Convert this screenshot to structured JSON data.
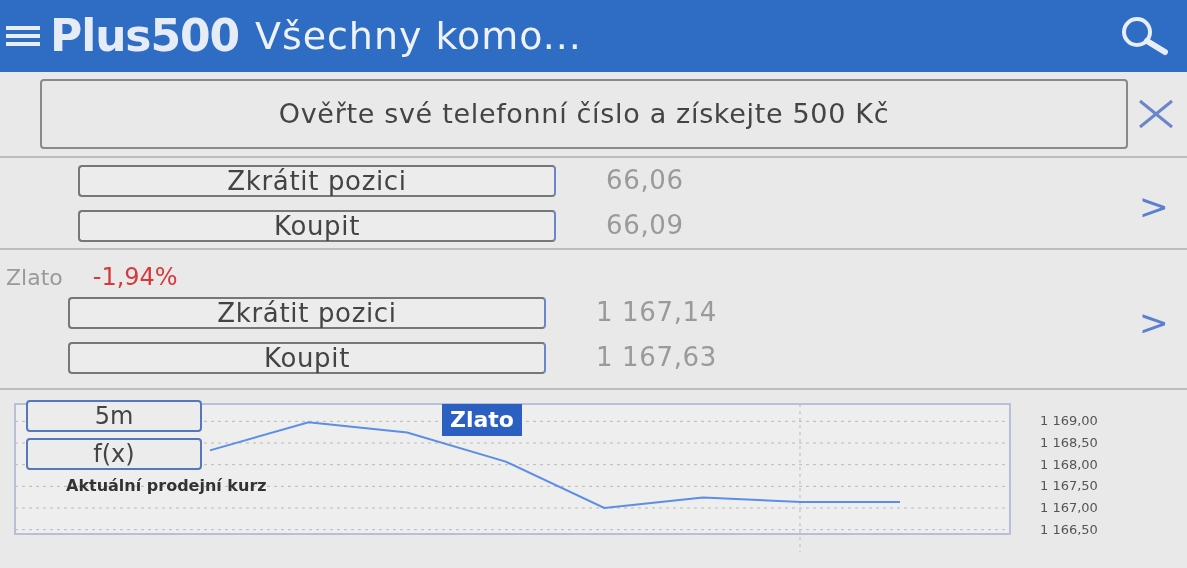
{
  "header": {
    "logo": "Plus500",
    "title": "Všechny komo..."
  },
  "banner": {
    "text": "Ověřte své telefonní číslo a získejte 500 Kč"
  },
  "instruments": [
    {
      "sell_label": "Zkrátit pozici",
      "sell_price": "66,06",
      "buy_label": "Koupit",
      "buy_price": "66,09",
      "arrow": ">"
    },
    {
      "name": "Zlato",
      "change": "-1,94%",
      "sell_label": "Zkrátit pozici",
      "sell_price": "1 167,14",
      "buy_label": "Koupit",
      "buy_price": "1 167,63",
      "arrow": ">"
    }
  ],
  "chart": {
    "buttons": [
      {
        "label": "5m"
      },
      {
        "label": "f(x)"
      }
    ],
    "chart_data": {
      "type": "line",
      "title": "Zlato",
      "grid": true,
      "series": [
        {
          "name": "Aktuální prodejní kurz",
          "color": "#5b8ee6",
          "values": [
            1168.33,
            1168.98,
            1168.74,
            1168.07,
            1167.0,
            1167.24,
            1167.14,
            1167.14
          ]
        }
      ],
      "ylim": [
        1166.4,
        1169.4
      ],
      "yticks": [
        {
          "value": 1169,
          "label": "1 169,00"
        },
        {
          "value": 1168.5,
          "label": "1 168,50"
        },
        {
          "value": 1168,
          "label": "1 168,00"
        },
        {
          "value": 1167.5,
          "label": "1 167,50"
        },
        {
          "value": 1167,
          "label": "1 167,00"
        },
        {
          "value": 1166.5,
          "label": "1 166,50"
        }
      ]
    }
  }
}
